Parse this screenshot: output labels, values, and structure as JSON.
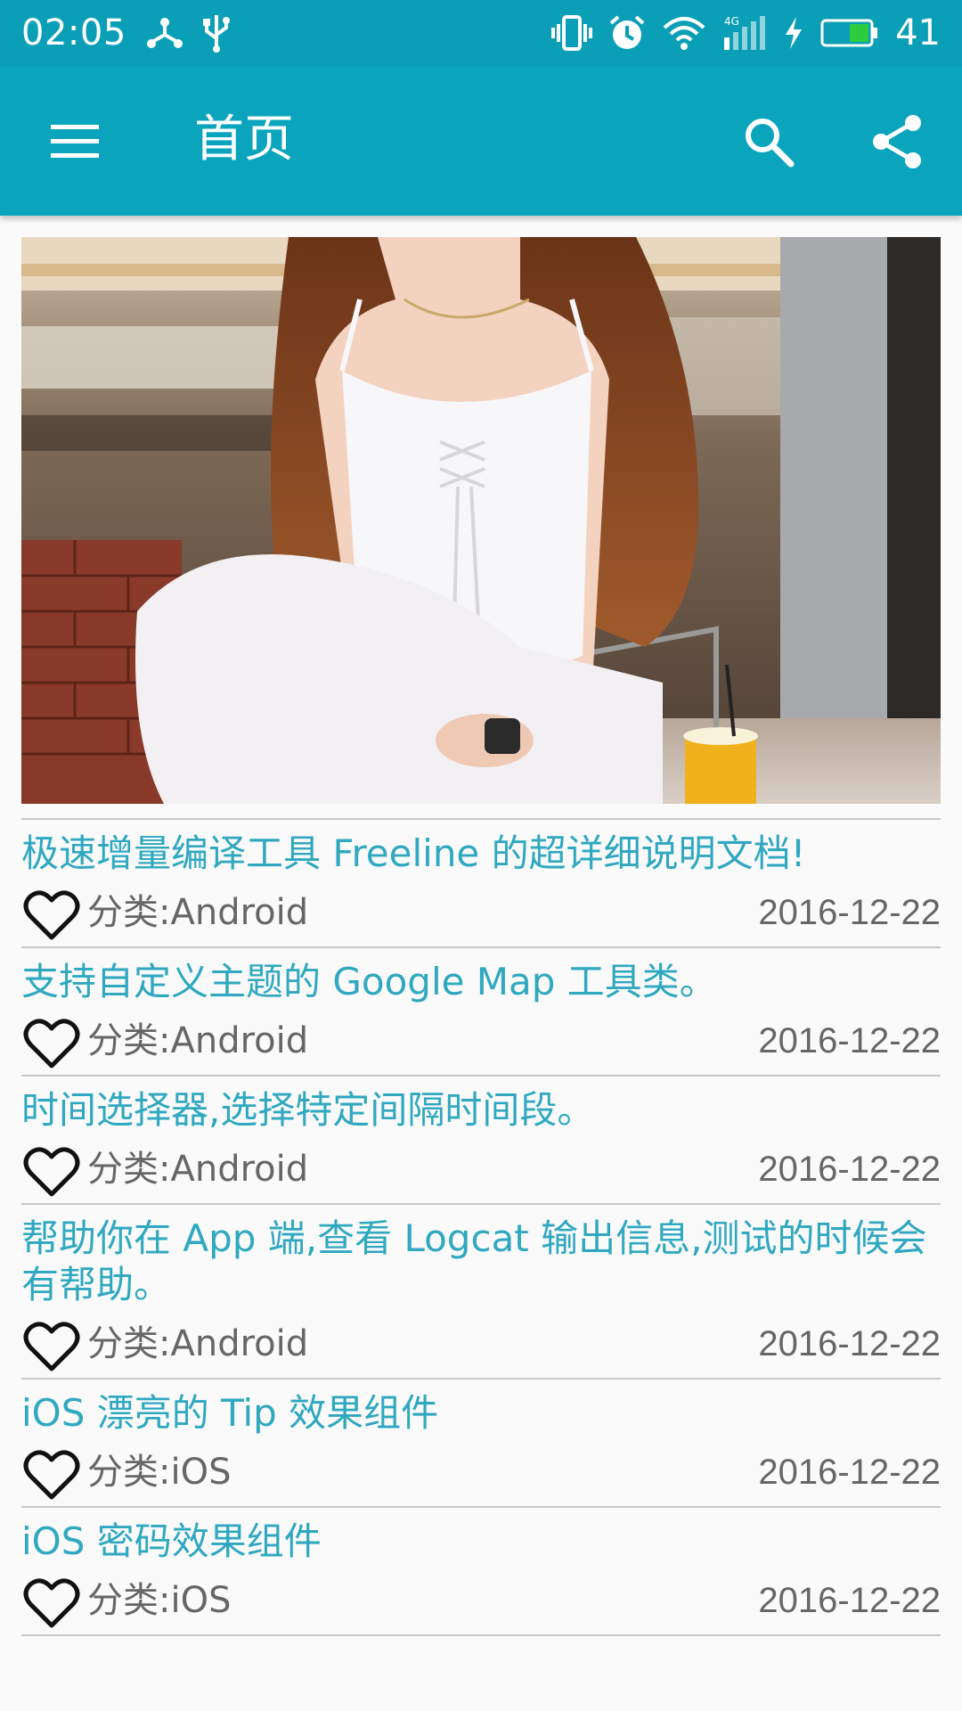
{
  "status_bar": {
    "time": "02:05",
    "network": "4G",
    "battery": "41",
    "battery_fill_fraction": 0.41,
    "battery_color": "#2ecc40",
    "icons": [
      "usb-tether-icon",
      "usb-icon",
      "vibrate-icon",
      "alarm-icon",
      "wifi-icon",
      "cellular-signal-icon",
      "charging-icon",
      "battery-icon"
    ]
  },
  "app_bar": {
    "title": "首页",
    "background": "#0aa5bd",
    "icons": [
      "menu-icon",
      "search-icon",
      "share-icon"
    ]
  },
  "banner": {
    "icon": "banner-photo"
  },
  "articles": [
    {
      "title": "极速增量编译工具 Freeline 的超详细说明文档!",
      "category": "分类:Android",
      "date": "2016-12-22"
    },
    {
      "title": "支持自定义主题的 Google Map 工具类。",
      "category": "分类:Android",
      "date": "2016-12-22"
    },
    {
      "title": "时间选择器,选择特定间隔时间段。",
      "category": "分类:Android",
      "date": "2016-12-22"
    },
    {
      "title": "帮助你在 App 端,查看 Logcat 输出信息,测试的时候会有帮助。",
      "category": "分类:Android",
      "date": "2016-12-22"
    },
    {
      "title": "iOS 漂亮的 Tip 效果组件",
      "category": "分类:iOS",
      "date": "2016-12-22"
    },
    {
      "title": "iOS 密码效果组件",
      "category": "分类:iOS",
      "date": "2016-12-22"
    }
  ],
  "colors": {
    "accent": "#0aa5bd",
    "title_text": "#2fa8c0",
    "meta_text": "#666666"
  }
}
